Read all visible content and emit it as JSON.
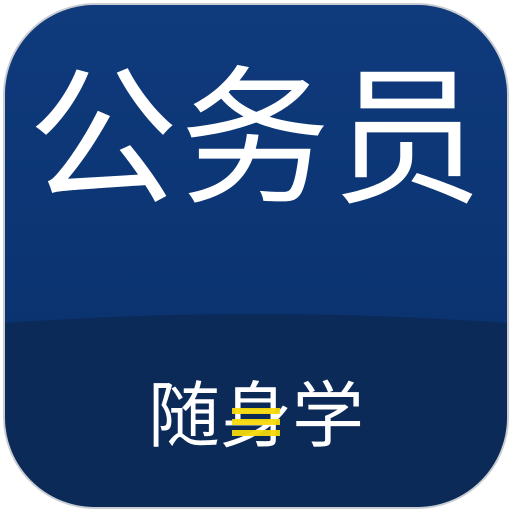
{
  "icon": {
    "title": "公务员",
    "subtitle_parts": [
      "随",
      "身",
      "学"
    ],
    "colors": {
      "primary_blue": "#0f3a7c",
      "dark_blue": "#0b2a58",
      "accent_yellow": "#f5d90a",
      "text": "#ffffff"
    }
  }
}
